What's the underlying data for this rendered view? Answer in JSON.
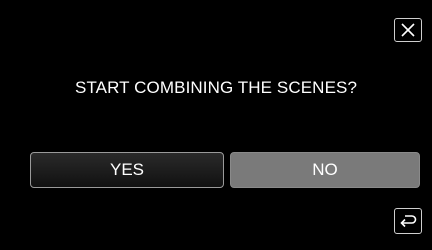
{
  "dialog": {
    "question": "START COMBINING THE SCENES?",
    "yes_label": "YES",
    "no_label": "NO"
  },
  "icons": {
    "close": "close-icon",
    "back": "return-arrow-icon"
  },
  "colors": {
    "background": "#000000",
    "text": "#ffffff",
    "no_button_fill": "#7a7a7a",
    "button_border": "#9a9a9a"
  }
}
